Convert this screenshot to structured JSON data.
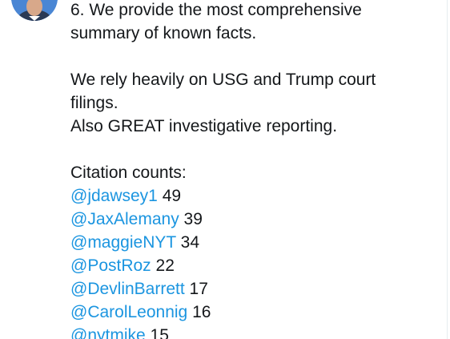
{
  "tweet": {
    "paragraph1": [
      "6. We provide the most comprehensive",
      "summary of known facts."
    ],
    "paragraph2": [
      "We rely heavily on USG and Trump court",
      "filings.",
      "Also GREAT investigative reporting."
    ],
    "citation_heading": "Citation counts:",
    "citations": [
      {
        "handle": "@jdawsey1",
        "count": "49"
      },
      {
        "handle": "@JaxAlemany",
        "count": "39"
      },
      {
        "handle": "@maggieNYT",
        "count": "34"
      },
      {
        "handle": "@PostRoz",
        "count": "22"
      },
      {
        "handle": "@DevlinBarrett",
        "count": "17"
      },
      {
        "handle": "@CarolLeonnig",
        "count": "16"
      },
      {
        "handle": "@nytmike",
        "count": "15"
      }
    ]
  },
  "colors": {
    "mention": "#1b95e0",
    "text": "#14171a",
    "border": "#e6ecf0"
  }
}
